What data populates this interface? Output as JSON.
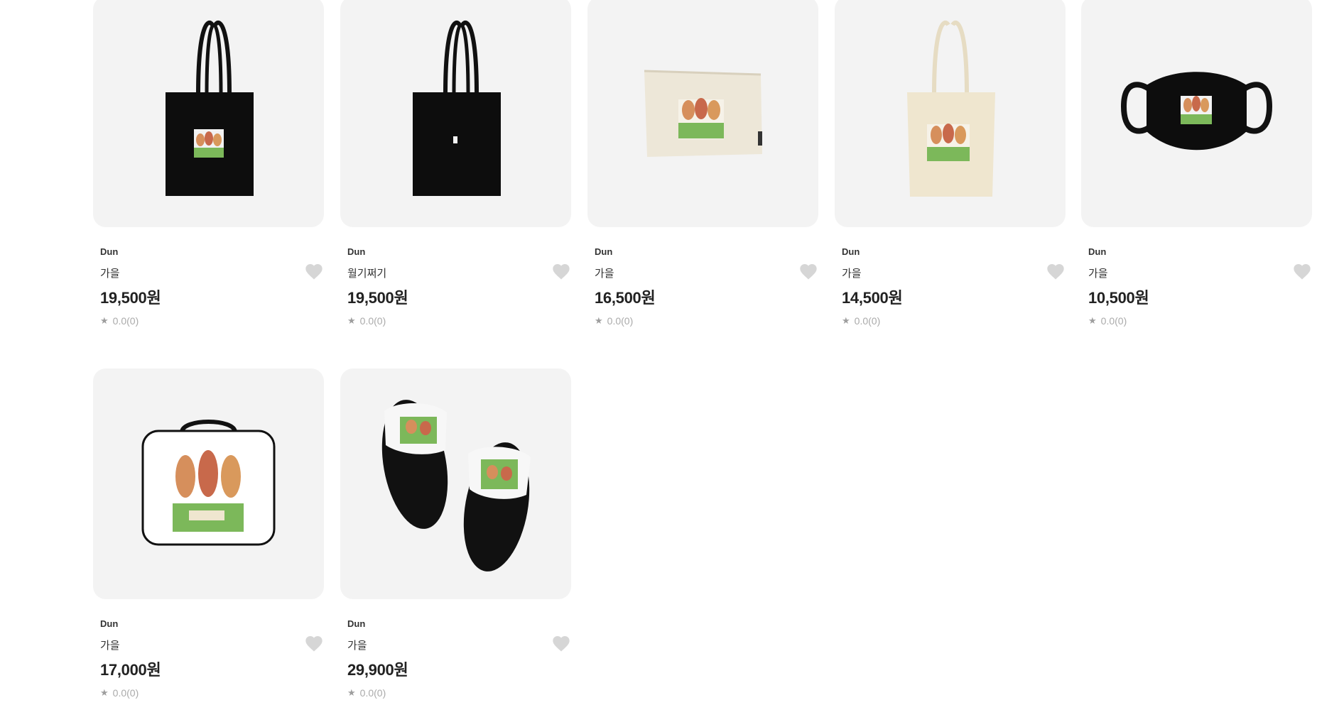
{
  "products": [
    {
      "seller": "Dun",
      "name": "가을",
      "price": "19,500원",
      "rating": "0.0(0)",
      "image": "black-tote-bag-print"
    },
    {
      "seller": "Dun",
      "name": "월기쩌기",
      "price": "19,500원",
      "rating": "0.0(0)",
      "image": "black-tote-bag-small-logo"
    },
    {
      "seller": "Dun",
      "name": "가을",
      "price": "16,500원",
      "rating": "0.0(0)",
      "image": "canvas-pouch-print"
    },
    {
      "seller": "Dun",
      "name": "가을",
      "price": "14,500원",
      "rating": "0.0(0)",
      "image": "ivory-tote-bag-print"
    },
    {
      "seller": "Dun",
      "name": "가을",
      "price": "10,500원",
      "rating": "0.0(0)",
      "image": "black-face-mask-print"
    },
    {
      "seller": "Dun",
      "name": "가을",
      "price": "17,000원",
      "rating": "0.0(0)",
      "image": "lunch-bag-print"
    },
    {
      "seller": "Dun",
      "name": "가을",
      "price": "29,900원",
      "rating": "0.0(0)",
      "image": "slide-sandals-print"
    }
  ],
  "colors": {
    "thumb_bg": "#f3f3f3",
    "price": "#222222",
    "heart": "#d6d6d6",
    "rating": "#aaaaaa"
  }
}
